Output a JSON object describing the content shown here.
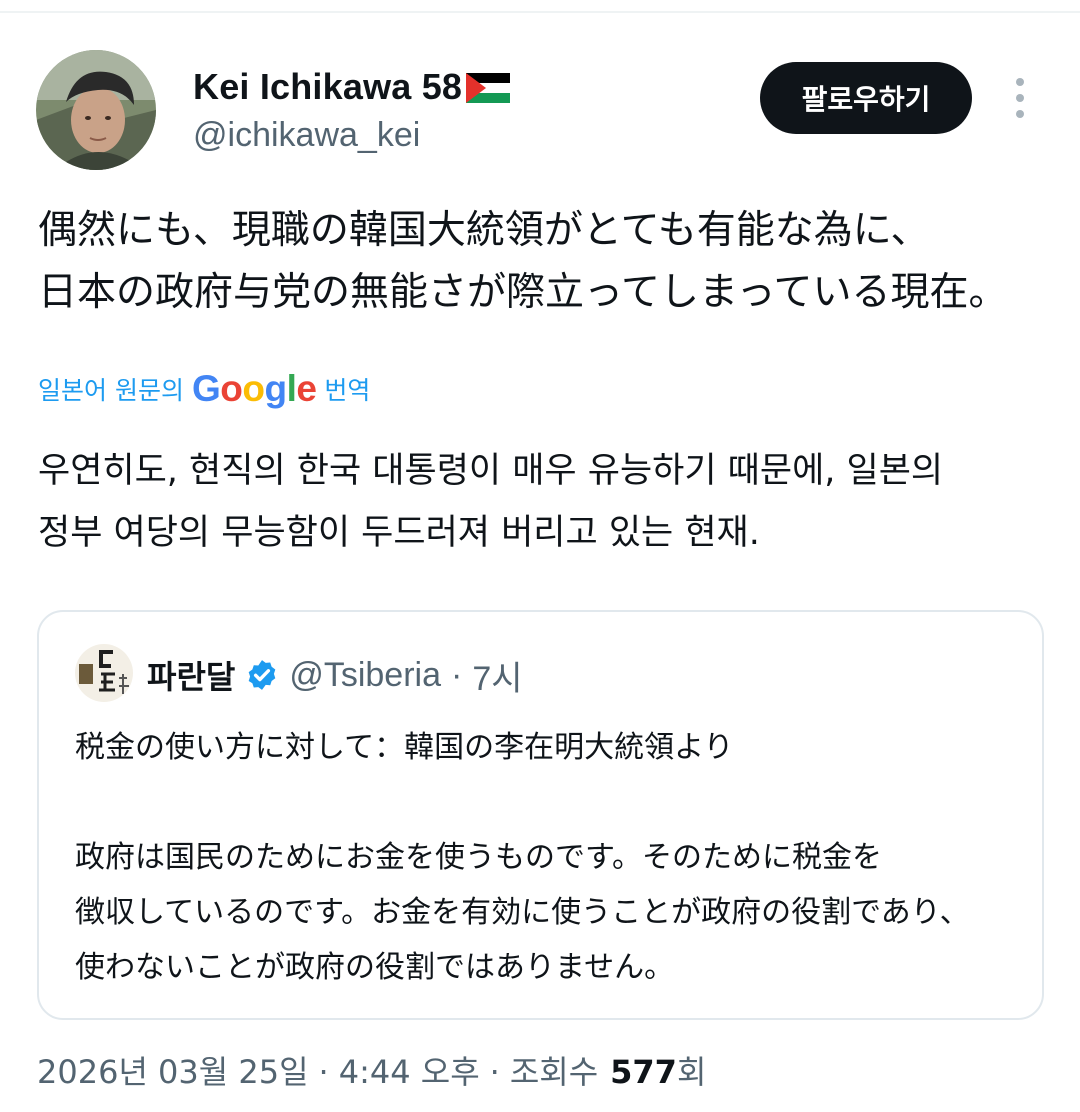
{
  "author": {
    "display_name": "Kei Ichikawa 58",
    "handle": "@ichikawa_kei",
    "flag_icon": "palestine-flag-icon"
  },
  "header": {
    "follow_label": "팔로우하기",
    "more_icon": "more-vertical-icon"
  },
  "tweet": {
    "text": "偶然にも、現職の韓国大統領がとても有能な為に、\n日本の政府与党の無能さが際立ってしまっている現在。",
    "translate_prefix": "일본어 원문의",
    "translate_suffix": "번역",
    "translated_text": "우연히도, 현직의 한국 대통령이 매우 유능하기 때문에, 일본의\n정부 여당의 무능함이 두드러져 버리고 있는 현재."
  },
  "quote": {
    "display_name": "파란달",
    "verified_icon": "verified-badge-icon",
    "handle": "@Tsiberia",
    "separator": "·",
    "time": "7시",
    "text": "税金の使い方に対して：韓国の李在明大統領より\n\n政府は国民のためにお金を使うものです。そのために税金を\n徴収しているのです。お金を有効に使うことが政府の役割であり、\n使わないことが政府の役割ではありません。"
  },
  "footer": {
    "date": "2026년 03월 25일",
    "separator": "·",
    "time": "4:44 오후",
    "views_label": "조회수",
    "views_count": "577",
    "views_suffix": "회"
  },
  "colors": {
    "text": "#0f1419",
    "muted": "#536471",
    "link": "#1d9bf0",
    "verified": "#1d9bf0",
    "button_bg": "#0f1419",
    "card_border": "#e1e8ed"
  }
}
